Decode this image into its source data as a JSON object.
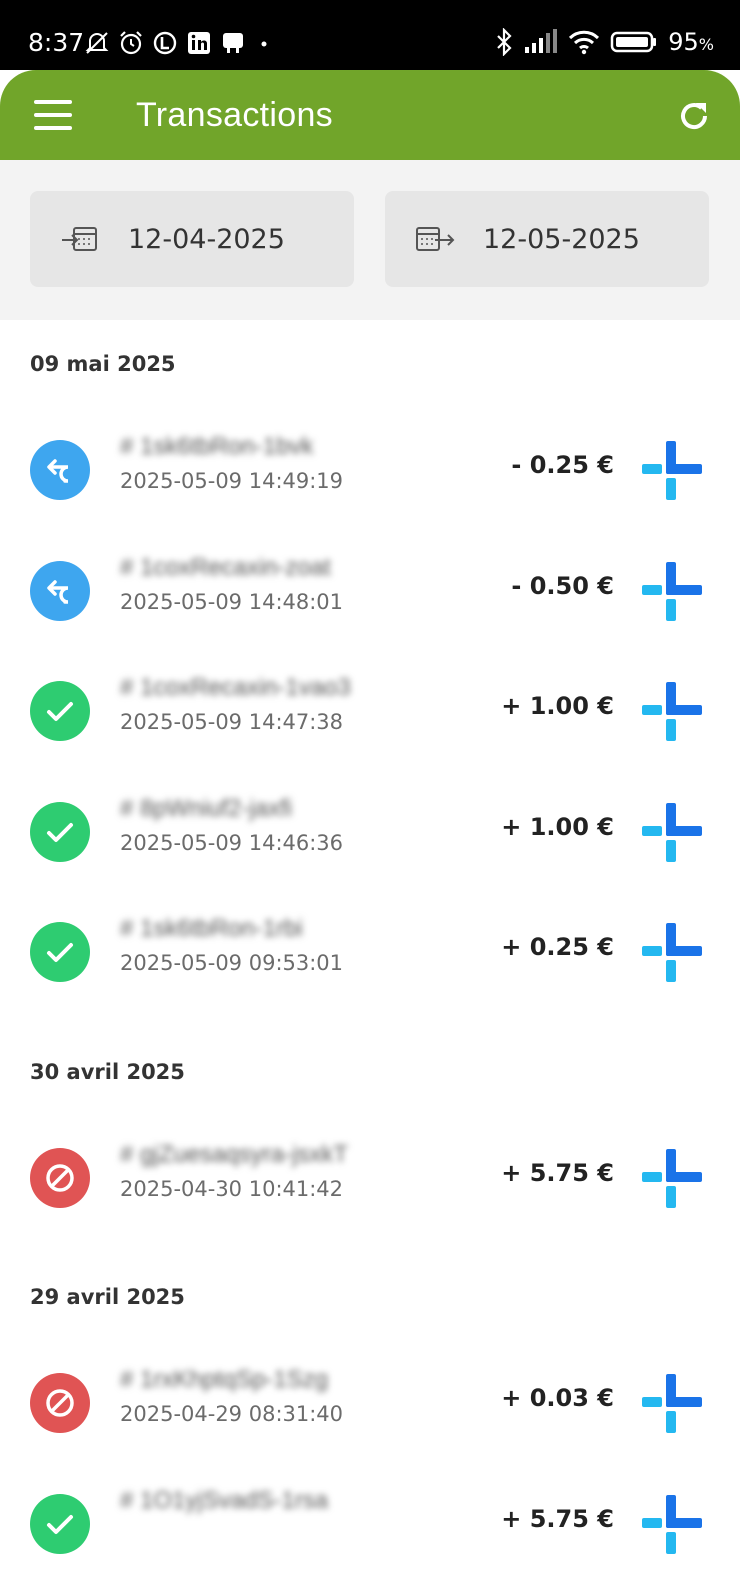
{
  "status_bar": {
    "time": "8:37",
    "battery_pct": "95",
    "battery_unit": "%",
    "icons": [
      "muted-bell-icon",
      "alarm-icon",
      "l-badge-icon",
      "linkedin-icon",
      "notification-icon",
      "dot-icon",
      "bluetooth-icon",
      "signal-icon",
      "wifi-icon",
      "battery-icon"
    ]
  },
  "app_bar": {
    "title": "Transactions",
    "color": "#71a52a",
    "icons": [
      "menu-icon",
      "refresh-icon"
    ]
  },
  "date_filter": {
    "from_date": "12-04-2025",
    "to_date": "12-05-2025"
  },
  "colors": {
    "refund": "#3ea6ef",
    "success": "#2ecc71",
    "cancelled": "#e05454",
    "provider_dark": "#1a73e8",
    "provider_light": "#24b8f0"
  },
  "groups": [
    {
      "date_label": "09 mai 2025",
      "transactions": [
        {
          "status": "refund",
          "reference": "# 1sk6tbRon-1bvk",
          "datetime": "2025-05-09 14:49:19",
          "amount": "- 0.25 €"
        },
        {
          "status": "refund",
          "reference": "# 1coxRecaxin-zoat",
          "datetime": "2025-05-09 14:48:01",
          "amount": "- 0.50 €"
        },
        {
          "status": "success",
          "reference": "# 1coxRecaxin-1vao3",
          "datetime": "2025-05-09 14:47:38",
          "amount": "+ 1.00 €"
        },
        {
          "status": "success",
          "reference": "# 8pWniuf2-jaxfi",
          "datetime": "2025-05-09 14:46:36",
          "amount": "+ 1.00 €"
        },
        {
          "status": "success",
          "reference": "# 1sk6tbRon-1rbi",
          "datetime": "2025-05-09 09:53:01",
          "amount": "+ 0.25 €"
        }
      ]
    },
    {
      "date_label": "30 avril 2025",
      "transactions": [
        {
          "status": "cancelled",
          "reference": "# gjZuesaqsyra-jsxkT",
          "datetime": "2025-04-30 10:41:42",
          "amount": "+ 5.75 €"
        }
      ]
    },
    {
      "date_label": "29 avril 2025",
      "transactions": [
        {
          "status": "cancelled",
          "reference": "# 1rxKhptqSp-1Szg",
          "datetime": "2025-04-29 08:31:40",
          "amount": "+ 0.03 €"
        },
        {
          "status": "success",
          "reference": "# 1O1yjSvadS-1rsa",
          "datetime": "",
          "amount": "+ 5.75 €"
        }
      ]
    }
  ]
}
